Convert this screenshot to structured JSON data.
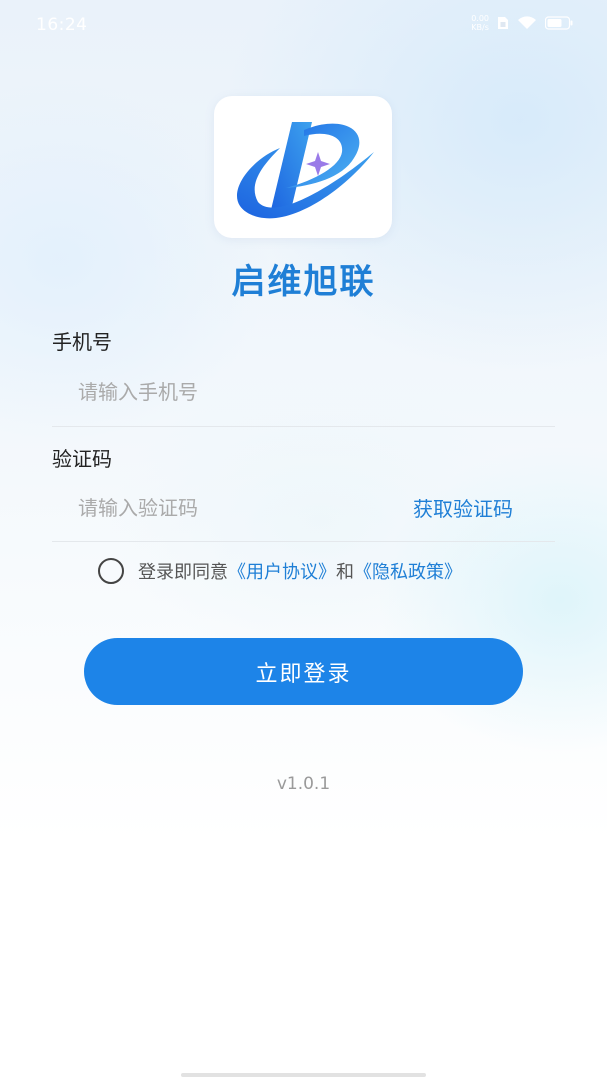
{
  "status_bar": {
    "time": "16:24",
    "net_speed_value": "0.00",
    "net_speed_unit": "KB/s",
    "icons": [
      "sim-icon",
      "wifi-icon",
      "battery-icon"
    ]
  },
  "app": {
    "name": "启维旭联",
    "logo": "app-logo-icon"
  },
  "form": {
    "phone": {
      "label": "手机号",
      "placeholder": "请输入手机号",
      "value": ""
    },
    "code": {
      "label": "验证码",
      "placeholder": "请输入验证码",
      "value": "",
      "get_code_label": "获取验证码"
    }
  },
  "agreement": {
    "checked": false,
    "prefix": "登录即同意",
    "user_agreement": "《用户协议》",
    "conjunction": "和",
    "privacy_policy": "《隐私政策》"
  },
  "login_button": {
    "label": "立即登录"
  },
  "version": "v1.0.1",
  "colors": {
    "accent": "#1f7fd6",
    "button": "#1d84e8",
    "label_text": "#222222",
    "placeholder": "#aaaaaa",
    "version_text": "#9a9a9a"
  }
}
